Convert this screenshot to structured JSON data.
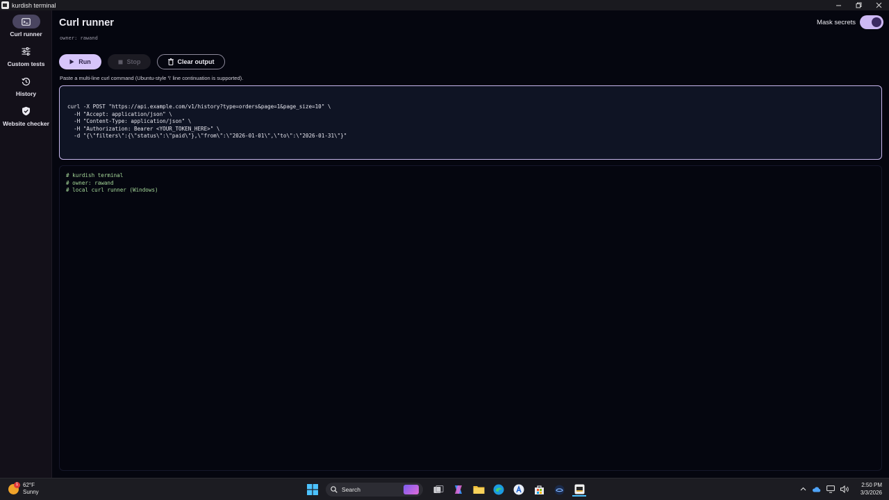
{
  "window": {
    "title": "kurdish terminal"
  },
  "sidebar": {
    "items": [
      {
        "label": "Curl runner",
        "icon": "terminal-icon",
        "active": true
      },
      {
        "label": "Custom tests",
        "icon": "sliders-icon"
      },
      {
        "label": "History",
        "icon": "history-icon"
      },
      {
        "label": "Website checker",
        "icon": "shield-check-icon"
      }
    ]
  },
  "header": {
    "title": "Curl runner",
    "owner": "owner: rawand",
    "mask_label": "Mask secrets",
    "mask_on": true
  },
  "toolbar": {
    "run": "Run",
    "stop": "Stop",
    "clear": "Clear output"
  },
  "hint": "Paste a multi-line curl command (Ubuntu-style '\\' line continuation is supported).",
  "command": {
    "lines": [
      "curl -X POST \"https://api.example.com/v1/history?type=orders&page=1&page_size=10\" \\",
      "  -H \"Accept: application/json\" \\",
      "  -H \"Content-Type: application/json\" \\",
      "  -H \"Authorization: Bearer <YOUR_TOKEN_HERE>\" \\",
      "  -d \"{\\\"filters\\\":{\\\"status\\\":\\\"paid\\\"},\\\"from\\\":\\\"2026-01-01\\\",\\\"to\\\":\\\"2026-01-31\\\"}\""
    ]
  },
  "output": {
    "lines": [
      "# kurdish terminal",
      "# owner: rawand",
      "# local curl runner (Windows)"
    ]
  },
  "taskbar": {
    "temp": "62°F",
    "condition": "Sunny",
    "weather_badge": "1",
    "search": "Search",
    "time": "2:50 PM",
    "date": "3/3/2026"
  },
  "colors": {
    "accent": "#d6c4fa",
    "output_text": "#a6d99a",
    "background": "#05060f"
  }
}
